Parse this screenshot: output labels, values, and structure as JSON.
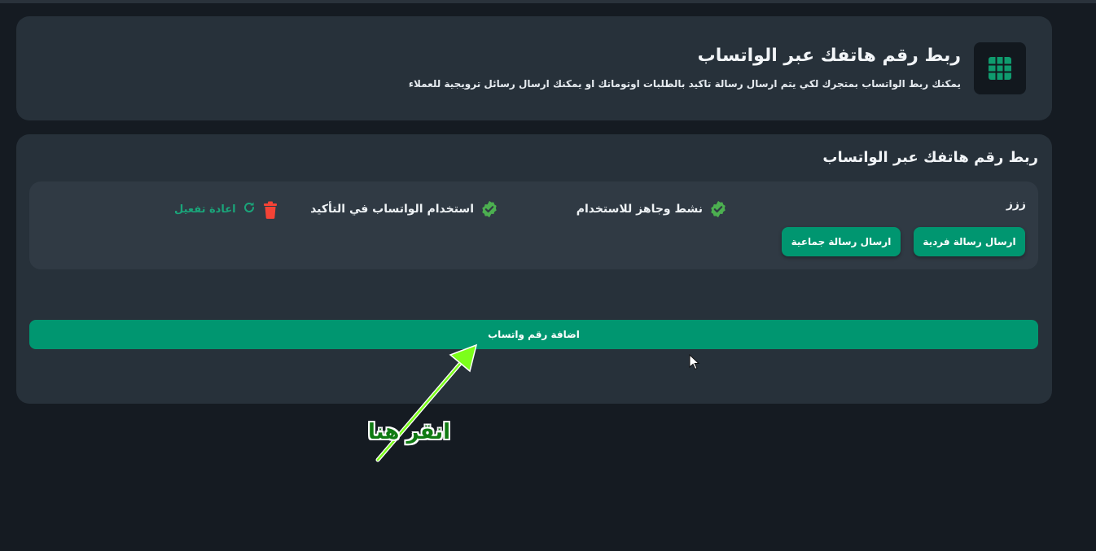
{
  "header": {
    "title": "ربط رقم هاتفك عبر الواتساب",
    "subtitle": "يمكنك ربط الواتساب بمتجرك لكي يتم ارسال رسالة تاكيد بالطلبات اوتوماتك او يمكنك ارسال رسائل ترويجية للعملاء",
    "icon": "grid-icon"
  },
  "section": {
    "title": "ربط رقم هاتفك عبر الواتساب"
  },
  "device": {
    "name": "ززز",
    "status_active": "نشط وجاهز للاستخدام",
    "status_confirm": "استخدام الواتساب في التأكيد",
    "reactivate_label": "اعادة تفعيل",
    "send_single_label": "ارسال رسالة فردية",
    "send_group_label": "ارسال رسالة جماعية"
  },
  "add_button_label": "اضافة رقم واتساب",
  "annotation": {
    "text": "انقر هنا"
  },
  "colors": {
    "background": "#151b22",
    "card": "#27313a",
    "panel": "#303a44",
    "accent": "#009670",
    "check": "#4caf50",
    "danger": "#f44336",
    "arrow": "#7cff1a"
  }
}
